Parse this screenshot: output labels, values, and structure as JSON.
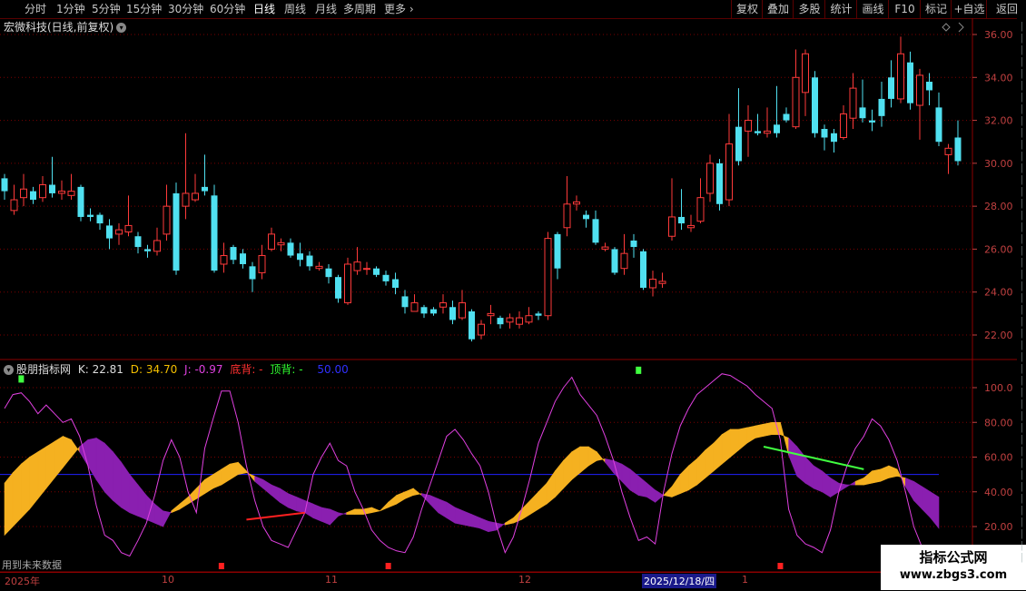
{
  "toolbar": {
    "periods": [
      "分时",
      "1分钟",
      "5分钟",
      "15分钟",
      "30分钟",
      "60分钟",
      "日线",
      "周线",
      "月线",
      "多周期",
      "更多"
    ],
    "selected": "日线",
    "right_buttons": [
      "复权",
      "叠加",
      "多股",
      "统计",
      "画线",
      "F10",
      "标记",
      "+自选",
      "返回"
    ]
  },
  "stock": {
    "title": "宏微科技(日线,前复权)"
  },
  "price_axis": [
    "36.00",
    "34.00",
    "32.00",
    "30.00",
    "28.00",
    "26.00",
    "24.00",
    "22.00"
  ],
  "indicator": {
    "name": "股朋指标网",
    "k": "K: 22.81",
    "d": "D: 34.70",
    "j": "J: -0.97",
    "bottom_div": "底背: -",
    "top_div": "顶背: -",
    "level": "50.00",
    "axis": [
      "100.0",
      "80.00",
      "60.00",
      "40.00",
      "20.00"
    ]
  },
  "dates": [
    "2025年",
    "10",
    "11",
    "12",
    "2025/12/18/四",
    "1"
  ],
  "future_text": "用到未来数据",
  "watermark": {
    "line1": "指标公式网",
    "line2": "www.zbgs3.com"
  },
  "colors": {
    "up": "#ff3a3a",
    "down": "#50e0f0",
    "orange": "#f5b120",
    "purple": "#8a1fb0",
    "j_line": "#e040e0",
    "blue_line": "#2020ff"
  },
  "chart_data": {
    "type": "candlestick",
    "ylim": [
      21.3,
      36.6
    ],
    "candles": [
      [
        29.3,
        28.7,
        29.5,
        28.3
      ],
      [
        27.8,
        28.3,
        29.0,
        27.6
      ],
      [
        28.4,
        28.8,
        29.5,
        28.0
      ],
      [
        28.7,
        28.3,
        28.9,
        28.1
      ],
      [
        28.4,
        29.0,
        29.4,
        28.2
      ],
      [
        29.0,
        28.6,
        30.3,
        28.4
      ],
      [
        28.6,
        28.7,
        29.2,
        28.3
      ],
      [
        28.5,
        28.7,
        29.5,
        28.3
      ],
      [
        28.9,
        27.5,
        29.0,
        27.3
      ],
      [
        27.6,
        27.5,
        27.9,
        27.3
      ],
      [
        27.6,
        27.2,
        27.7,
        26.9
      ],
      [
        27.1,
        26.5,
        27.4,
        26.0
      ],
      [
        26.7,
        26.9,
        27.2,
        26.2
      ],
      [
        26.8,
        27.1,
        28.5,
        26.6
      ],
      [
        26.6,
        26.1,
        26.8,
        25.8
      ],
      [
        26.0,
        25.9,
        26.2,
        25.6
      ],
      [
        25.9,
        26.4,
        27.0,
        25.7
      ],
      [
        26.7,
        28.0,
        29.0,
        26.4
      ],
      [
        28.6,
        25.0,
        29.1,
        24.8
      ],
      [
        28.0,
        28.6,
        31.4,
        27.4
      ],
      [
        28.3,
        28.6,
        29.5,
        28.2
      ],
      [
        28.9,
        28.7,
        30.4,
        28.5
      ],
      [
        28.5,
        25.0,
        29.0,
        24.9
      ],
      [
        25.3,
        25.7,
        26.3,
        24.9
      ],
      [
        26.1,
        25.5,
        26.2,
        25.3
      ],
      [
        25.8,
        25.3,
        26.0,
        25.1
      ],
      [
        25.2,
        24.6,
        25.4,
        24.0
      ],
      [
        24.9,
        25.7,
        26.2,
        24.6
      ],
      [
        26.0,
        26.7,
        27.0,
        25.9
      ],
      [
        26.2,
        26.3,
        26.5,
        25.9
      ],
      [
        26.3,
        25.7,
        26.5,
        25.6
      ],
      [
        25.8,
        25.5,
        26.3,
        25.2
      ],
      [
        25.7,
        25.2,
        25.9,
        25.0
      ],
      [
        25.1,
        25.2,
        25.4,
        25.0
      ],
      [
        25.1,
        24.7,
        25.3,
        24.4
      ],
      [
        24.7,
        23.7,
        24.8,
        23.5
      ],
      [
        23.5,
        25.3,
        25.6,
        23.4
      ],
      [
        25.0,
        25.4,
        26.1,
        24.8
      ],
      [
        25.1,
        25.1,
        25.4,
        24.8
      ],
      [
        25.1,
        24.8,
        25.2,
        24.7
      ],
      [
        24.8,
        24.5,
        25.0,
        24.3
      ],
      [
        24.6,
        24.2,
        24.9,
        23.9
      ],
      [
        23.8,
        23.3,
        24.1,
        23.0
      ],
      [
        23.1,
        23.5,
        23.9,
        23.1
      ],
      [
        23.3,
        23.0,
        23.4,
        22.8
      ],
      [
        23.2,
        23.0,
        23.3,
        22.9
      ],
      [
        23.3,
        23.5,
        23.9,
        23.0
      ],
      [
        23.3,
        22.7,
        23.6,
        22.5
      ],
      [
        22.8,
        23.5,
        24.1,
        22.7
      ],
      [
        23.1,
        21.8,
        23.2,
        21.7
      ],
      [
        22.0,
        22.5,
        22.7,
        21.8
      ],
      [
        22.9,
        23.0,
        23.4,
        22.5
      ],
      [
        22.8,
        22.5,
        22.9,
        22.3
      ],
      [
        22.6,
        22.8,
        23.0,
        22.3
      ],
      [
        22.5,
        22.8,
        23.1,
        22.3
      ],
      [
        22.6,
        22.9,
        23.3,
        22.5
      ],
      [
        23.0,
        22.9,
        23.1,
        22.7
      ],
      [
        22.9,
        26.5,
        26.8,
        22.7
      ],
      [
        26.7,
        25.1,
        26.8,
        24.6
      ],
      [
        27.0,
        28.1,
        29.4,
        26.6
      ],
      [
        28.1,
        28.2,
        28.5,
        27.8
      ],
      [
        27.6,
        27.4,
        27.8,
        27.0
      ],
      [
        27.4,
        26.3,
        27.8,
        26.2
      ],
      [
        26.0,
        26.1,
        26.3,
        25.9
      ],
      [
        26.0,
        24.9,
        26.1,
        24.8
      ],
      [
        25.1,
        25.8,
        26.7,
        24.8
      ],
      [
        26.4,
        26.1,
        26.7,
        25.6
      ],
      [
        25.9,
        24.2,
        26.0,
        24.1
      ],
      [
        24.2,
        24.6,
        25.0,
        23.8
      ],
      [
        24.4,
        24.5,
        24.9,
        24.2
      ],
      [
        26.6,
        27.5,
        29.3,
        26.4
      ],
      [
        27.5,
        27.2,
        28.8,
        26.9
      ],
      [
        27.0,
        27.1,
        27.6,
        26.8
      ],
      [
        27.3,
        28.4,
        29.3,
        27.2
      ],
      [
        28.6,
        30.0,
        30.4,
        28.2
      ],
      [
        30.0,
        28.1,
        30.2,
        27.8
      ],
      [
        28.3,
        30.9,
        32.3,
        28.0
      ],
      [
        31.7,
        30.1,
        33.5,
        29.9
      ],
      [
        31.5,
        32.0,
        32.7,
        30.3
      ],
      [
        31.5,
        31.4,
        32.3,
        31.3
      ],
      [
        31.4,
        31.5,
        32.6,
        31.2
      ],
      [
        31.8,
        31.4,
        33.6,
        31.2
      ],
      [
        32.3,
        32.0,
        32.6,
        31.9
      ],
      [
        31.7,
        34.0,
        35.3,
        31.6
      ],
      [
        33.3,
        35.1,
        35.3,
        32.2
      ],
      [
        34.0,
        31.4,
        34.3,
        31.2
      ],
      [
        31.6,
        31.2,
        31.8,
        30.6
      ],
      [
        31.4,
        31.0,
        31.6,
        30.5
      ],
      [
        31.2,
        32.3,
        32.7,
        31.1
      ],
      [
        32.1,
        33.5,
        34.2,
        31.6
      ],
      [
        32.6,
        32.1,
        33.9,
        31.9
      ],
      [
        32.0,
        31.9,
        32.5,
        31.5
      ],
      [
        33.0,
        32.2,
        33.8,
        31.7
      ],
      [
        34.0,
        33.0,
        34.8,
        32.6
      ],
      [
        33.0,
        35.1,
        35.9,
        32.8
      ],
      [
        34.7,
        32.8,
        35.2,
        32.5
      ],
      [
        32.7,
        34.1,
        34.4,
        31.1
      ],
      [
        33.8,
        33.4,
        34.2,
        32.7
      ],
      [
        32.6,
        31.0,
        33.3,
        30.8
      ],
      [
        30.4,
        30.7,
        30.9,
        29.5
      ],
      [
        31.2,
        30.1,
        32.0,
        29.9
      ]
    ],
    "kdj": {
      "indicator_ylim": [
        9,
        110
      ],
      "k_line": [
        45,
        51,
        56,
        60,
        63,
        66,
        69,
        72,
        70,
        63,
        55,
        47,
        40,
        35,
        31,
        28,
        26,
        24,
        22,
        20,
        29,
        33,
        37,
        42,
        47,
        50,
        53,
        56,
        57,
        52,
        46,
        42,
        38,
        34,
        31,
        29,
        28,
        25,
        23,
        21,
        26,
        28,
        30,
        30,
        31,
        29,
        34,
        38,
        40,
        42,
        38,
        33,
        28,
        25,
        22,
        21,
        20,
        19,
        17,
        18,
        22,
        25,
        30,
        35,
        40,
        45,
        52,
        58,
        63,
        66,
        66,
        63,
        57,
        51,
        46,
        41,
        38,
        37,
        34,
        38,
        43,
        50,
        55,
        59,
        64,
        68,
        73,
        76,
        76,
        77,
        78,
        79,
        80,
        80,
        61,
        49,
        45,
        42,
        40,
        37,
        40,
        43,
        46,
        48,
        52,
        53,
        55,
        53,
        43,
        35,
        30,
        25,
        19
      ],
      "d_line": [
        15,
        20,
        25,
        30,
        36,
        42,
        48,
        54,
        60,
        66,
        70,
        71,
        68,
        63,
        57,
        50,
        44,
        38,
        33,
        29,
        28,
        30,
        33,
        36,
        39,
        42,
        44,
        47,
        50,
        51,
        49,
        47,
        44,
        42,
        39,
        37,
        35,
        33,
        31,
        30,
        28,
        27,
        27,
        27,
        28,
        29,
        31,
        33,
        36,
        38,
        39,
        38,
        36,
        34,
        31,
        29,
        27,
        25,
        23,
        22,
        21,
        22,
        24,
        27,
        30,
        33,
        37,
        42,
        47,
        51,
        55,
        58,
        59,
        58,
        56,
        53,
        49,
        45,
        41,
        38,
        37,
        39,
        41,
        44,
        48,
        52,
        56,
        60,
        64,
        68,
        71,
        72,
        73,
        73,
        71,
        66,
        60,
        55,
        52,
        48,
        45,
        44,
        44,
        44,
        45,
        46,
        48,
        49,
        48,
        46,
        43,
        40,
        37
      ],
      "j_line": [
        88,
        96,
        97,
        92,
        85,
        90,
        85,
        80,
        82,
        72,
        55,
        32,
        15,
        12,
        5,
        3,
        12,
        22,
        38,
        58,
        70,
        60,
        40,
        28,
        65,
        82,
        98,
        98,
        80,
        55,
        35,
        20,
        12,
        10,
        8,
        18,
        28,
        50,
        60,
        68,
        58,
        55,
        40,
        30,
        18,
        12,
        8,
        6,
        5,
        14,
        30,
        44,
        58,
        72,
        76,
        70,
        62,
        55,
        40,
        20,
        5,
        14,
        30,
        48,
        68,
        80,
        92,
        100,
        106,
        96,
        90,
        84,
        72,
        58,
        40,
        25,
        12,
        14,
        10,
        40,
        62,
        78,
        88,
        96,
        100,
        104,
        108,
        107,
        104,
        101,
        96,
        92,
        88,
        70,
        30,
        15,
        10,
        8,
        5,
        18,
        40,
        55,
        65,
        72,
        82,
        78,
        70,
        58,
        40,
        20,
        8,
        5,
        0
      ]
    }
  }
}
